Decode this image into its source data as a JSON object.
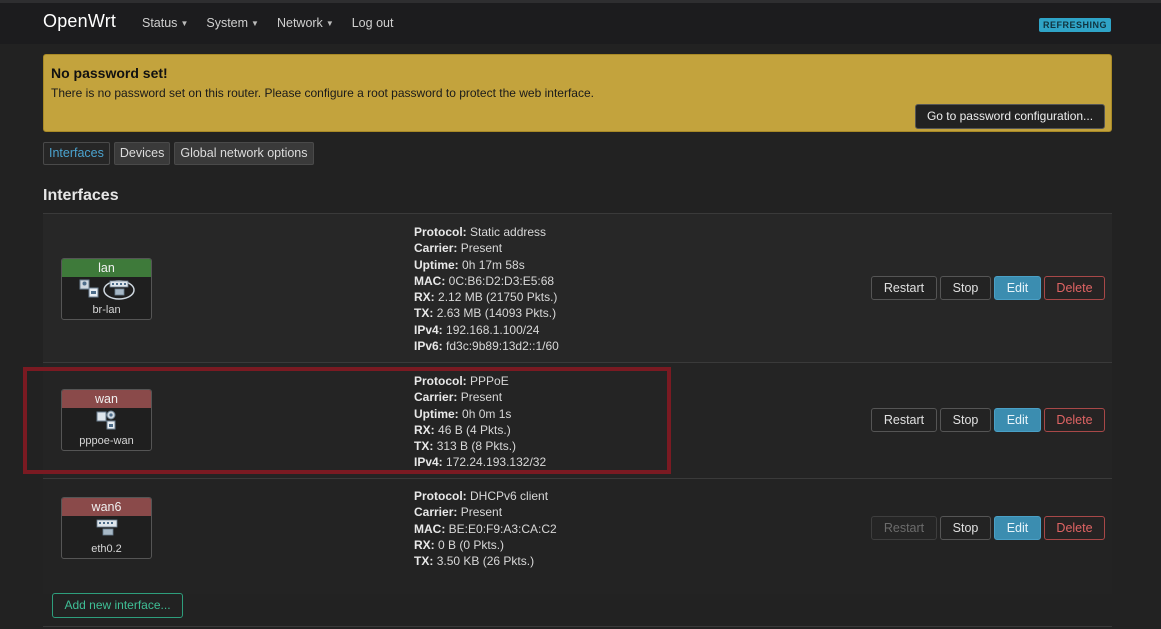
{
  "header": {
    "brand": "OpenWrt",
    "menu": [
      {
        "label": "Status",
        "has_dropdown": true
      },
      {
        "label": "System",
        "has_dropdown": true
      },
      {
        "label": "Network",
        "has_dropdown": true
      },
      {
        "label": "Log out",
        "has_dropdown": false
      }
    ],
    "indicator": "REFRESHING"
  },
  "alert": {
    "title": "No password set!",
    "text": "There is no password set on this router. Please configure a root password to protect the web interface.",
    "button": "Go to password configuration...",
    "background": "#c3a33d"
  },
  "tabs": [
    {
      "label": "Interfaces",
      "active": true
    },
    {
      "label": "Devices",
      "active": false
    },
    {
      "label": "Global network options",
      "active": false
    }
  ],
  "section_title": "Interfaces",
  "interfaces": [
    {
      "name": "lan",
      "device": "br-lan",
      "color": "#3e7a3a",
      "icons": [
        "user-ethernet-icon",
        "switch-icon"
      ],
      "details": [
        {
          "label": "Protocol:",
          "value": "Static address"
        },
        {
          "label": "Carrier:",
          "value": "Present"
        },
        {
          "label": "Uptime:",
          "value": "0h 17m 58s"
        },
        {
          "label": "MAC:",
          "value": "0C:B6:D2:D3:E5:68"
        },
        {
          "label": "RX:",
          "value": "2.12 MB (21750 Pkts.)"
        },
        {
          "label": "TX:",
          "value": "2.63 MB (14093 Pkts.)"
        },
        {
          "label": "IPv4:",
          "value": "192.168.1.100/24"
        },
        {
          "label": "IPv6:",
          "value": "fd3c:9b89:13d2::1/60"
        }
      ],
      "actions": {
        "restart": "Restart",
        "stop": "Stop",
        "edit": "Edit",
        "delete": "Delete",
        "restart_disabled": false
      }
    },
    {
      "name": "wan",
      "device": "pppoe-wan",
      "color": "#8a4a4a",
      "icons": [
        "pppoe-icon"
      ],
      "details": [
        {
          "label": "Protocol:",
          "value": "PPPoE"
        },
        {
          "label": "Carrier:",
          "value": "Present"
        },
        {
          "label": "Uptime:",
          "value": "0h 0m 1s"
        },
        {
          "label": "RX:",
          "value": "46 B (4 Pkts.)"
        },
        {
          "label": "TX:",
          "value": "313 B (8 Pkts.)"
        },
        {
          "label": "IPv4:",
          "value": "172.24.193.132/32"
        }
      ],
      "actions": {
        "restart": "Restart",
        "stop": "Stop",
        "edit": "Edit",
        "delete": "Delete",
        "restart_disabled": false
      }
    },
    {
      "name": "wan6",
      "device": "eth0.2",
      "color": "#8a4a4a",
      "icons": [
        "ethernet-port-icon"
      ],
      "details": [
        {
          "label": "Protocol:",
          "value": "DHCPv6 client"
        },
        {
          "label": "Carrier:",
          "value": "Present"
        },
        {
          "label": "MAC:",
          "value": "BE:E0:F9:A3:CA:C2"
        },
        {
          "label": "RX:",
          "value": "0 B (0 Pkts.)"
        },
        {
          "label": "TX:",
          "value": "3.50 KB (26 Pkts.)"
        }
      ],
      "actions": {
        "restart": "Restart",
        "stop": "Stop",
        "edit": "Edit",
        "delete": "Delete",
        "restart_disabled": true
      }
    }
  ],
  "add_button": "Add new interface...",
  "highlight_color": "#7a1a22"
}
